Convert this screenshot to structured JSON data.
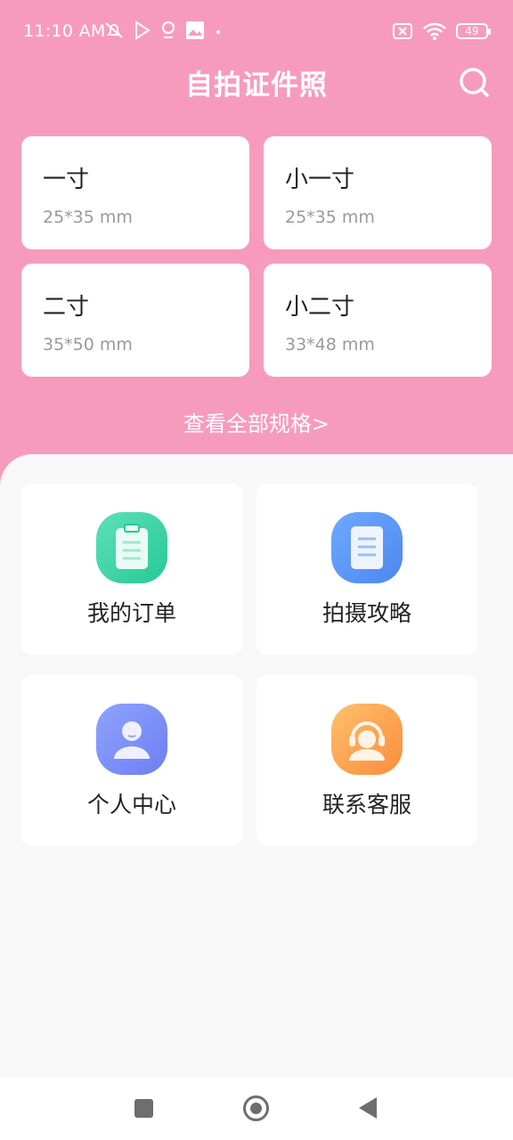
{
  "status_bar": {
    "time": "11:10 AM",
    "battery": "49",
    "icons": [
      "mute-icon",
      "play-store-icon",
      "location-icon",
      "gallery-icon",
      "dot-icon",
      "sim-icon",
      "wifi-icon",
      "battery-icon"
    ]
  },
  "header": {
    "title": "自拍证件照",
    "search_icon": "search-icon"
  },
  "sizes": [
    {
      "name": "一寸",
      "dim": "25*35 mm"
    },
    {
      "name": "小一寸",
      "dim": "25*35 mm"
    },
    {
      "name": "二寸",
      "dim": "35*50 mm"
    },
    {
      "name": "小二寸",
      "dim": "33*48 mm"
    }
  ],
  "view_all": "查看全部规格>",
  "menu": [
    {
      "label": "我的订单",
      "icon": "clipboard-icon",
      "color": "#25c996"
    },
    {
      "label": "拍摄攻略",
      "icon": "document-icon",
      "color": "#4d87f0"
    },
    {
      "label": "个人中心",
      "icon": "user-icon",
      "color": "#6d7ef2"
    },
    {
      "label": "联系客服",
      "icon": "headset-icon",
      "color": "#fb8c3e"
    }
  ],
  "colors": {
    "accent": "#f79bbd",
    "background": "#f8f8f8"
  }
}
